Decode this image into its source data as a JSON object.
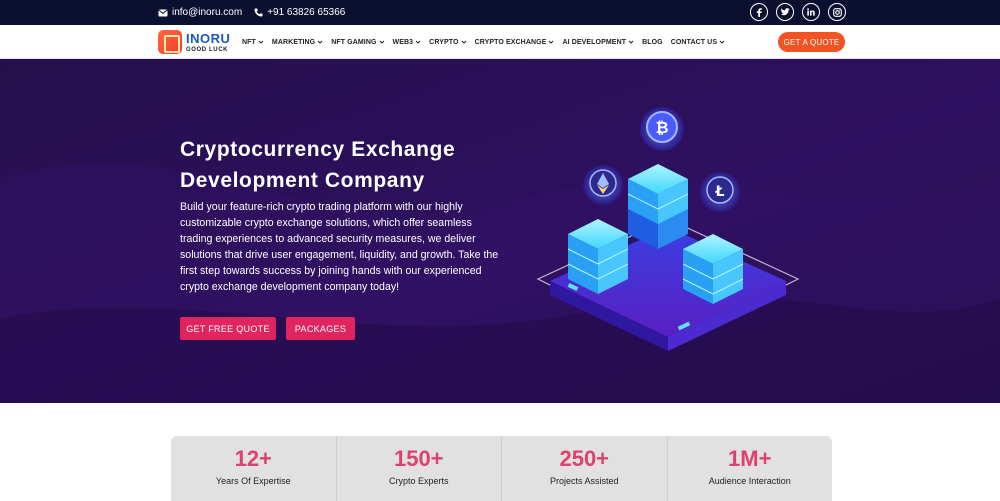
{
  "topbar": {
    "email": "info@inoru.com",
    "phone": "+91 63826 65366",
    "social": [
      {
        "icon": "facebook-icon",
        "glyph": "f"
      },
      {
        "icon": "twitter-icon",
        "glyph": "t"
      },
      {
        "icon": "linkedin-icon",
        "glyph": "in"
      },
      {
        "icon": "instagram-icon",
        "glyph": "ig"
      }
    ]
  },
  "brand": {
    "name": "INORU",
    "tagline": "GOOD LUCK"
  },
  "nav": {
    "items": [
      {
        "label": "NFT",
        "dropdown": true
      },
      {
        "label": "MARKETING",
        "dropdown": true
      },
      {
        "label": "NFT GAMING",
        "dropdown": true
      },
      {
        "label": "WEB3",
        "dropdown": true
      },
      {
        "label": "CRYPTO",
        "dropdown": true
      },
      {
        "label": "CRYPTO EXCHANGE",
        "dropdown": true
      },
      {
        "label": "AI DEVELOPMENT",
        "dropdown": true
      },
      {
        "label": "BLOG",
        "dropdown": false
      },
      {
        "label": "CONTACT US",
        "dropdown": true
      }
    ],
    "cta": "GET A QUOTE"
  },
  "hero": {
    "title_line1": "Cryptocurrency Exchange",
    "title_line2": "Development Company",
    "description": "Build your feature-rich crypto trading platform with our highly customizable crypto exchange solutions, which offer seamless trading experiences to advanced security measures, we deliver solutions that drive user engagement, liquidity, and growth. Take the first step towards success by joining hands with our experienced crypto exchange development company today!",
    "button_primary": "GET FREE QUOTE",
    "button_secondary": "PACKAGES",
    "illustration_icons": [
      "bitcoin-icon",
      "ethereum-icon",
      "litecoin-icon"
    ]
  },
  "stats": [
    {
      "value": "12+",
      "label": "Years Of Expertise"
    },
    {
      "value": "150+",
      "label": "Crypto Experts"
    },
    {
      "value": "250+",
      "label": "Projects Assisted"
    },
    {
      "value": "1M+",
      "label": "Audience Interaction"
    }
  ],
  "colors": {
    "topbar": "#0b1030",
    "hero": "#2a0f55",
    "accent": "#f25323",
    "button": "#e0245e",
    "stat_value": "#e04070",
    "brand_blue": "#1a57c7"
  }
}
